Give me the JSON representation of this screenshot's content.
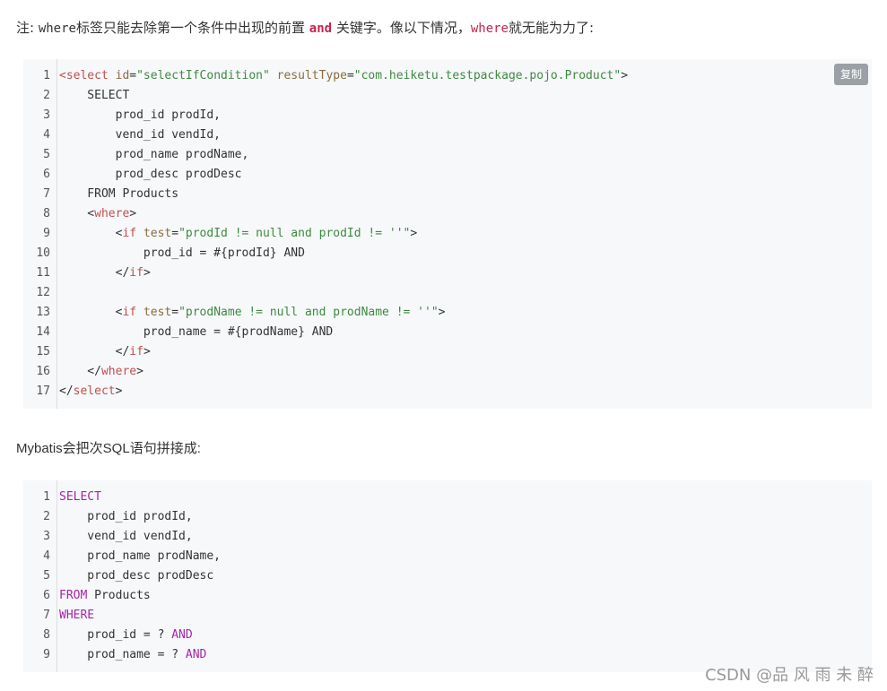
{
  "note": {
    "prefix": "注: ",
    "where1": "where",
    "mid": "标签只能去除第一个条件中出现的前置 ",
    "and": "and",
    "mid2": " 关键字。像以下情况，",
    "where2": "where",
    "suffix": "就无能为力了:"
  },
  "copy_label": "复制",
  "block1": {
    "lines": [
      {
        "n": "1",
        "parts": [
          [
            "tag",
            "<select "
          ],
          [
            "attr",
            "id"
          ],
          [
            "plain",
            "="
          ],
          [
            "str",
            "\"selectIfCondition\""
          ],
          [
            "plain",
            " "
          ],
          [
            "attr",
            "resultType"
          ],
          [
            "plain",
            "="
          ],
          [
            "str",
            "\"com.heiketu.testpackage.pojo.Product\""
          ],
          [
            "plain",
            ">"
          ]
        ]
      },
      {
        "n": "2",
        "parts": [
          [
            "plain",
            "    SELECT"
          ]
        ]
      },
      {
        "n": "3",
        "parts": [
          [
            "plain",
            "        prod_id prodId,"
          ]
        ]
      },
      {
        "n": "4",
        "parts": [
          [
            "plain",
            "        vend_id vendId,"
          ]
        ]
      },
      {
        "n": "5",
        "parts": [
          [
            "plain",
            "        prod_name prodName,"
          ]
        ]
      },
      {
        "n": "6",
        "parts": [
          [
            "plain",
            "        prod_desc prodDesc"
          ]
        ]
      },
      {
        "n": "7",
        "parts": [
          [
            "plain",
            "    FROM Products"
          ]
        ]
      },
      {
        "n": "8",
        "parts": [
          [
            "plain",
            "    <"
          ],
          [
            "tag",
            "where"
          ],
          [
            "plain",
            ">"
          ]
        ]
      },
      {
        "n": "9",
        "parts": [
          [
            "plain",
            "        <"
          ],
          [
            "tag",
            "if"
          ],
          [
            "plain",
            " "
          ],
          [
            "attr",
            "test"
          ],
          [
            "plain",
            "="
          ],
          [
            "str",
            "\"prodId != null and prodId != ''\""
          ],
          [
            "plain",
            ">"
          ]
        ]
      },
      {
        "n": "10",
        "parts": [
          [
            "plain",
            "            prod_id = #{prodId} AND"
          ]
        ]
      },
      {
        "n": "11",
        "parts": [
          [
            "plain",
            "        </"
          ],
          [
            "tag",
            "if"
          ],
          [
            "plain",
            ">"
          ]
        ]
      },
      {
        "n": "12",
        "parts": [
          [
            "plain",
            ""
          ]
        ]
      },
      {
        "n": "13",
        "parts": [
          [
            "plain",
            "        <"
          ],
          [
            "tag",
            "if"
          ],
          [
            "plain",
            " "
          ],
          [
            "attr",
            "test"
          ],
          [
            "plain",
            "="
          ],
          [
            "str",
            "\"prodName != null and prodName != ''\""
          ],
          [
            "plain",
            ">"
          ]
        ]
      },
      {
        "n": "14",
        "parts": [
          [
            "plain",
            "            prod_name = #{prodName} AND"
          ]
        ]
      },
      {
        "n": "15",
        "parts": [
          [
            "plain",
            "        </"
          ],
          [
            "tag",
            "if"
          ],
          [
            "plain",
            ">"
          ]
        ]
      },
      {
        "n": "16",
        "parts": [
          [
            "plain",
            "    </"
          ],
          [
            "tag",
            "where"
          ],
          [
            "plain",
            ">"
          ]
        ]
      },
      {
        "n": "17",
        "parts": [
          [
            "plain",
            "</"
          ],
          [
            "tag",
            "select"
          ],
          [
            "plain",
            ">"
          ]
        ]
      }
    ]
  },
  "paragraph": "Mybatis会把次SQL语句拼接成:",
  "block2": {
    "lines": [
      {
        "n": "1",
        "parts": [
          [
            "sqlkw",
            "SELECT"
          ]
        ]
      },
      {
        "n": "2",
        "parts": [
          [
            "plain",
            "    prod_id prodId,"
          ]
        ]
      },
      {
        "n": "3",
        "parts": [
          [
            "plain",
            "    vend_id vendId,"
          ]
        ]
      },
      {
        "n": "4",
        "parts": [
          [
            "plain",
            "    prod_name prodName,"
          ]
        ]
      },
      {
        "n": "5",
        "parts": [
          [
            "plain",
            "    prod_desc prodDesc"
          ]
        ]
      },
      {
        "n": "6",
        "parts": [
          [
            "sqlkw",
            "FROM"
          ],
          [
            "plain",
            " Products"
          ]
        ]
      },
      {
        "n": "7",
        "parts": [
          [
            "sqlkw",
            "WHERE"
          ]
        ]
      },
      {
        "n": "8",
        "parts": [
          [
            "plain",
            "    prod_id = ? "
          ],
          [
            "sqlkw",
            "AND"
          ]
        ]
      },
      {
        "n": "9",
        "parts": [
          [
            "plain",
            "    prod_name = ? "
          ],
          [
            "sqlkw",
            "AND"
          ]
        ]
      }
    ]
  },
  "watermark": "CSDN @品 风 ⾬ 未 醉"
}
